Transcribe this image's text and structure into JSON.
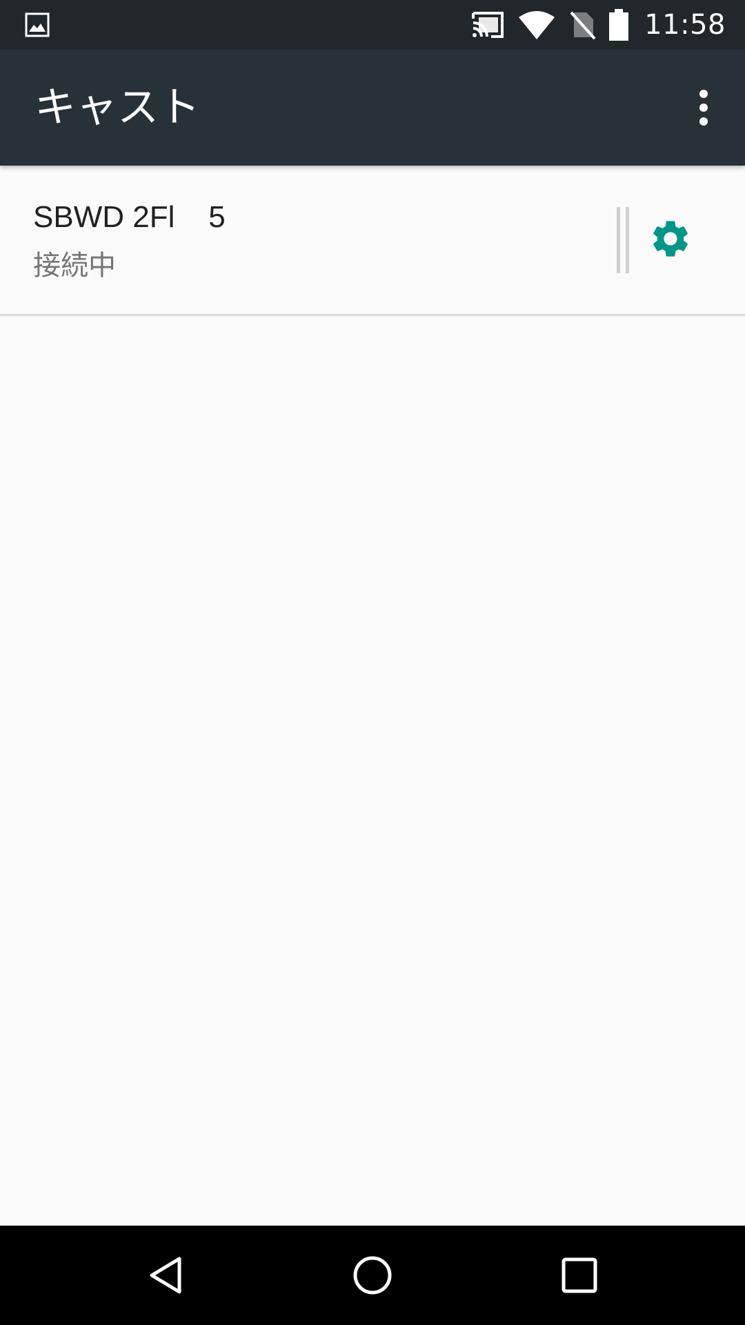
{
  "status_bar": {
    "time": "11:58",
    "icons": [
      "image-notification-icon",
      "cast-connected-icon",
      "wifi-icon",
      "no-sim-icon",
      "battery-icon"
    ]
  },
  "app_bar": {
    "title": "キャスト",
    "overflow_icon": "more-vert-icon"
  },
  "devices": [
    {
      "name": "SBWD 2Fl    5",
      "status": "接続中",
      "settings_icon": "gear-icon"
    }
  ],
  "colors": {
    "status_bar": "#21272b",
    "app_bar": "#263238",
    "background": "#fafafa",
    "accent": "#009688",
    "nav_bar": "#000000"
  },
  "nav_bar": {
    "icons": [
      "back-icon",
      "home-icon",
      "recents-icon"
    ]
  }
}
